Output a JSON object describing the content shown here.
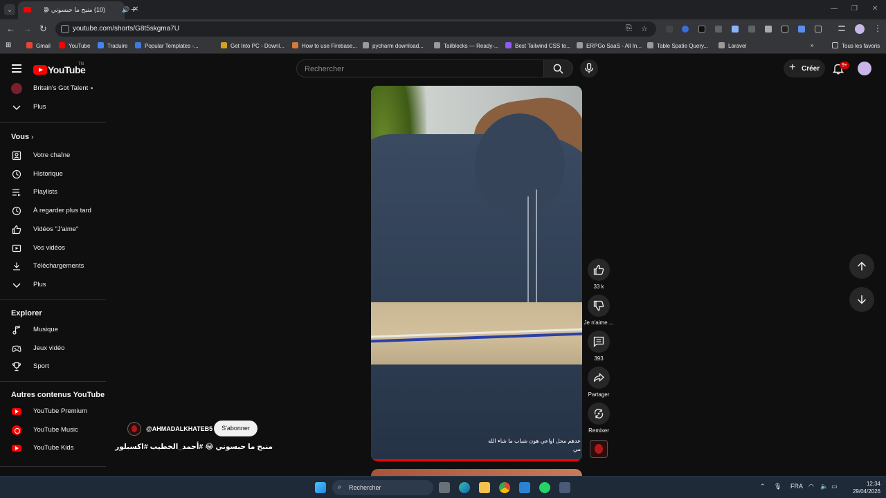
{
  "browser": {
    "tab_title": "(10) منبح ما حبسوني 😂 #أحـ",
    "url": "youtube.com/shorts/G8t5skgma7U",
    "bookmarks": [
      {
        "label": "Gmail",
        "color": "#ea4335"
      },
      {
        "label": "YouTube",
        "color": "#ff0000"
      },
      {
        "label": "Traduire",
        "color": "#4285f4"
      },
      {
        "label": "Popular Templates -...",
        "color": "#3f7ae0"
      },
      {
        "label": "Get Into PC - Downl...",
        "color": "#d4a020"
      },
      {
        "label": "How to use Firebase...",
        "color": "#d47a3a"
      },
      {
        "label": "pycharm download...",
        "color": "#9a9a9a"
      },
      {
        "label": "Tailblocks — Ready-...",
        "color": "#9a9a9a"
      },
      {
        "label": "Best Tailwind CSS te...",
        "color": "#8b5cf6"
      },
      {
        "label": "ERPGo SaaS - All In...",
        "color": "#9a9a9a"
      },
      {
        "label": "Table Spatie Query...",
        "color": "#9a9a9a"
      },
      {
        "label": "Laravel",
        "color": "#9a9a9a"
      }
    ],
    "all_bookmarks": "Tous les favoris"
  },
  "yt": {
    "logo": "YouTube",
    "logo_region": "TN",
    "search_placeholder": "Rechercher",
    "create_label": "Créer",
    "notif_badge": "9+"
  },
  "sidebar": {
    "top": [
      {
        "label": "Britain's Got Talent",
        "icon": "channel-avatar"
      },
      {
        "label": "Plus",
        "icon": "chevron-down-icon"
      }
    ],
    "you_heading": "Vous",
    "you_items": [
      {
        "label": "Votre chaîne",
        "icon": "channel-icon"
      },
      {
        "label": "Historique",
        "icon": "history-icon"
      },
      {
        "label": "Playlists",
        "icon": "playlist-icon"
      },
      {
        "label": "À regarder plus tard",
        "icon": "clock-icon"
      },
      {
        "label": "Vidéos \"J'aime\"",
        "icon": "thumbs-up-icon"
      },
      {
        "label": "Vos vidéos",
        "icon": "video-icon"
      },
      {
        "label": "Téléchargements",
        "icon": "download-icon"
      },
      {
        "label": "Plus",
        "icon": "chevron-down-icon"
      }
    ],
    "explore_heading": "Explorer",
    "explore_items": [
      {
        "label": "Musique",
        "icon": "music-icon"
      },
      {
        "label": "Jeux vidéo",
        "icon": "gaming-icon"
      },
      {
        "label": "Sport",
        "icon": "trophy-icon"
      }
    ],
    "more_heading": "Autres contenus YouTube",
    "more_items": [
      {
        "label": "YouTube Premium",
        "icon": "youtube-premium-icon"
      },
      {
        "label": "YouTube Music",
        "icon": "youtube-music-icon"
      },
      {
        "label": "YouTube Kids",
        "icon": "youtube-kids-icon"
      }
    ]
  },
  "short": {
    "caption_line1": "عدهم محل اواعي هون شباب ما شاء الله",
    "caption_line2": "مي",
    "channel_handle": "@AHMADALKHATEB5",
    "subscribe_label": "S'abonner",
    "title": "منبح ما حبسوني 😂 #أحمد_الخطيب #اكسبلور",
    "likes": "33 k",
    "dislike_label": "Je n'aime ...",
    "comments": "393",
    "share_label": "Partager",
    "remix_label": "Remixer"
  },
  "taskbar": {
    "search_label": "Rechercher",
    "language": "FRA",
    "time": "12:34",
    "date": "29/04/2026"
  }
}
